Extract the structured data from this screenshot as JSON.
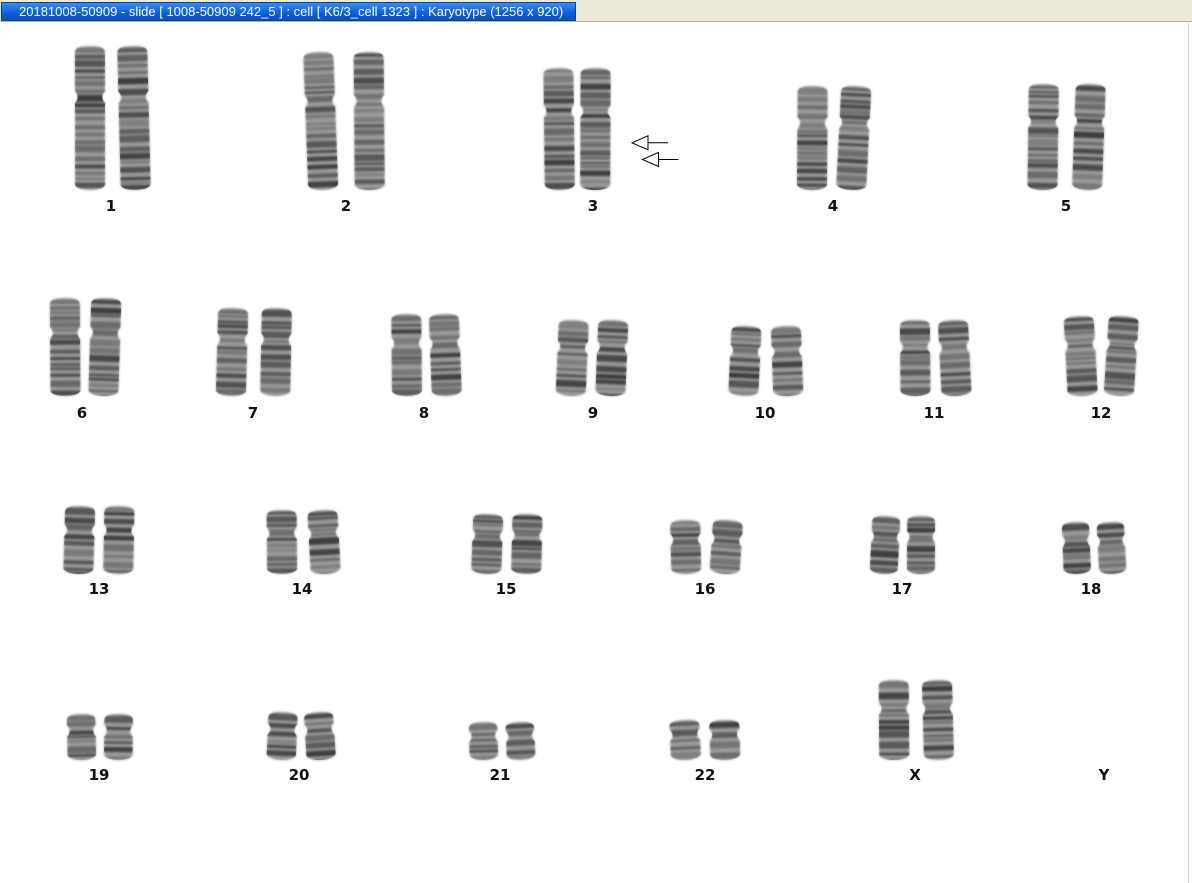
{
  "window": {
    "title": "20181008-50909 - slide [ 1008-50909 242_5 ] : cell [ K6/3_cell 1323 ] : Karyotype  (1256 x 920)"
  },
  "karyotype": {
    "chromosomes": [
      {
        "label": "1"
      },
      {
        "label": "2"
      },
      {
        "label": "3"
      },
      {
        "label": "4"
      },
      {
        "label": "5"
      },
      {
        "label": "6"
      },
      {
        "label": "7"
      },
      {
        "label": "8"
      },
      {
        "label": "9"
      },
      {
        "label": "10"
      },
      {
        "label": "11"
      },
      {
        "label": "12"
      },
      {
        "label": "13"
      },
      {
        "label": "14"
      },
      {
        "label": "15"
      },
      {
        "label": "16"
      },
      {
        "label": "17"
      },
      {
        "label": "18"
      },
      {
        "label": "19"
      },
      {
        "label": "20"
      },
      {
        "label": "21"
      },
      {
        "label": "22"
      },
      {
        "label": "X"
      },
      {
        "label": "Y"
      }
    ],
    "annotations": [
      {
        "type": "arrow",
        "chromosome": "3",
        "count": 2
      }
    ],
    "colors": {
      "chromatin_dark": "#2a2a2a",
      "chromatin_light": "#9a9a9a",
      "label": "#111111"
    }
  }
}
